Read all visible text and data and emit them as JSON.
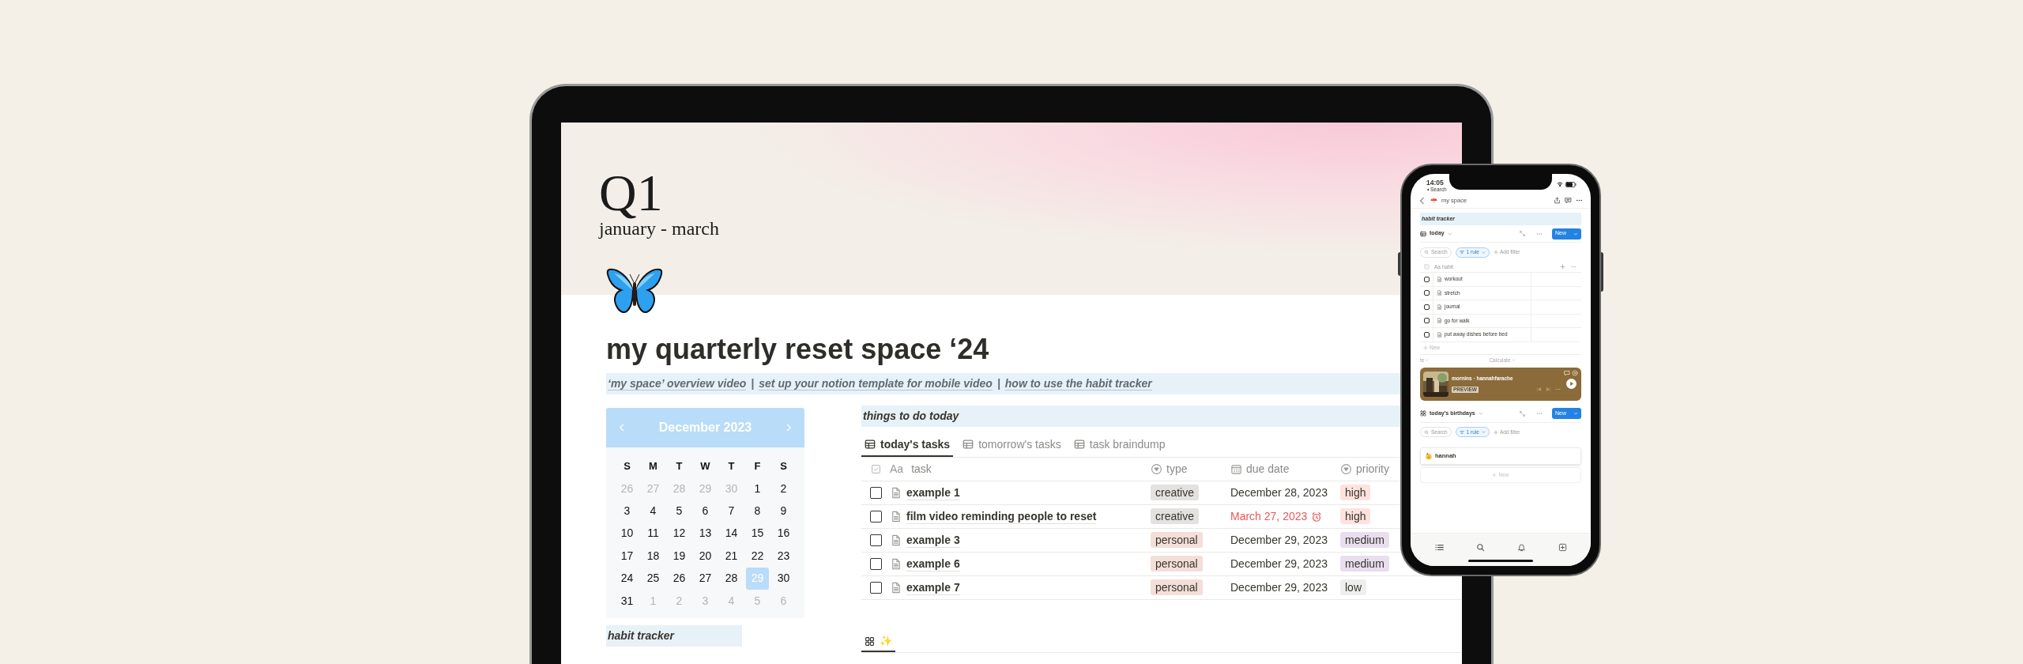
{
  "laptop": {
    "cover": {
      "title": "Q1",
      "subtitle": "january - march"
    },
    "page_title": "my quarterly reset space ‘24",
    "links": [
      {
        "kind": "link",
        "text": "‘my space’ overview video"
      },
      {
        "kind": "separator",
        "text": "|"
      },
      {
        "kind": "link",
        "text": "set up your notion template for mobile video"
      },
      {
        "kind": "separator",
        "text": "|"
      },
      {
        "kind": "link",
        "text": "how to use the habit tracker"
      }
    ],
    "calendar": {
      "month": "December 2023",
      "weekdays": [
        "S",
        "M",
        "T",
        "W",
        "T",
        "F",
        "S"
      ],
      "days": [
        {
          "label": "26",
          "outside": true,
          "selected": false
        },
        {
          "label": "27",
          "outside": true,
          "selected": false
        },
        {
          "label": "28",
          "outside": true,
          "selected": false
        },
        {
          "label": "29",
          "outside": true,
          "selected": false
        },
        {
          "label": "30",
          "outside": true,
          "selected": false
        },
        {
          "label": "1",
          "outside": false,
          "selected": false
        },
        {
          "label": "2",
          "outside": false,
          "selected": false
        },
        {
          "label": "3",
          "outside": false,
          "selected": false
        },
        {
          "label": "4",
          "outside": false,
          "selected": false
        },
        {
          "label": "5",
          "outside": false,
          "selected": false
        },
        {
          "label": "6",
          "outside": false,
          "selected": false
        },
        {
          "label": "7",
          "outside": false,
          "selected": false
        },
        {
          "label": "8",
          "outside": false,
          "selected": false
        },
        {
          "label": "9",
          "outside": false,
          "selected": false
        },
        {
          "label": "10",
          "outside": false,
          "selected": false
        },
        {
          "label": "11",
          "outside": false,
          "selected": false
        },
        {
          "label": "12",
          "outside": false,
          "selected": false
        },
        {
          "label": "13",
          "outside": false,
          "selected": false
        },
        {
          "label": "14",
          "outside": false,
          "selected": false
        },
        {
          "label": "15",
          "outside": false,
          "selected": false
        },
        {
          "label": "16",
          "outside": false,
          "selected": false
        },
        {
          "label": "17",
          "outside": false,
          "selected": false
        },
        {
          "label": "18",
          "outside": false,
          "selected": false
        },
        {
          "label": "19",
          "outside": false,
          "selected": false
        },
        {
          "label": "20",
          "outside": false,
          "selected": false
        },
        {
          "label": "21",
          "outside": false,
          "selected": false
        },
        {
          "label": "22",
          "outside": false,
          "selected": false
        },
        {
          "label": "23",
          "outside": false,
          "selected": false
        },
        {
          "label": "24",
          "outside": false,
          "selected": false
        },
        {
          "label": "25",
          "outside": false,
          "selected": false
        },
        {
          "label": "26",
          "outside": false,
          "selected": false
        },
        {
          "label": "27",
          "outside": false,
          "selected": false
        },
        {
          "label": "28",
          "outside": false,
          "selected": false
        },
        {
          "label": "29",
          "outside": false,
          "selected": true
        },
        {
          "label": "30",
          "outside": false,
          "selected": false
        },
        {
          "label": "31",
          "outside": false,
          "selected": false
        },
        {
          "label": "1",
          "outside": true,
          "selected": false
        },
        {
          "label": "2",
          "outside": true,
          "selected": false
        },
        {
          "label": "3",
          "outside": true,
          "selected": false
        },
        {
          "label": "4",
          "outside": true,
          "selected": false
        },
        {
          "label": "5",
          "outside": true,
          "selected": false
        },
        {
          "label": "6",
          "outside": true,
          "selected": false
        }
      ]
    },
    "habit_tracker": {
      "title": "habit tracker"
    },
    "tasks": {
      "title": "things to do today",
      "tabs": [
        {
          "label": "today's tasks",
          "selected": true
        },
        {
          "label": "tomorrow's tasks",
          "selected": false
        },
        {
          "label": "task braindump",
          "selected": false
        }
      ],
      "columns": [
        {
          "kind": "title",
          "prefix": "Aa",
          "label": "task"
        },
        {
          "kind": "select",
          "label": "type"
        },
        {
          "kind": "date",
          "label": "due date"
        },
        {
          "kind": "select",
          "label": "priority"
        }
      ],
      "rows": [
        {
          "checked": false,
          "task": "example 1",
          "type": {
            "label": "creative",
            "color": "#e3e2e0"
          },
          "due": {
            "text": "December 28, 2023",
            "overdue": false
          },
          "priority": {
            "label": "high",
            "color": "#ffe2dd"
          }
        },
        {
          "checked": false,
          "task": "film video reminding people to reset",
          "type": {
            "label": "creative",
            "color": "#e3e2e0"
          },
          "due": {
            "text": "March 27, 2023",
            "overdue": true
          },
          "priority": {
            "label": "high",
            "color": "#ffe2dd"
          }
        },
        {
          "checked": false,
          "task": "example 3",
          "type": {
            "label": "personal",
            "color": "#f4dfd8"
          },
          "due": {
            "text": "December 29, 2023",
            "overdue": false
          },
          "priority": {
            "label": "medium",
            "color": "#e8deee"
          }
        },
        {
          "checked": false,
          "task": "example 6",
          "type": {
            "label": "personal",
            "color": "#f4dfd8"
          },
          "due": {
            "text": "December 29, 2023",
            "overdue": false
          },
          "priority": {
            "label": "medium",
            "color": "#e8deee"
          }
        },
        {
          "checked": false,
          "task": "example 7",
          "type": {
            "label": "personal",
            "color": "#f4dfd8"
          },
          "due": {
            "text": "December 29, 2023",
            "overdue": false
          },
          "priority": {
            "label": "low",
            "color": "#eeeeed"
          }
        }
      ]
    },
    "bottom_tab": {
      "label": "✨",
      "selected": true
    }
  },
  "phone": {
    "time": "14:05",
    "back_label": "Search",
    "page": "my space",
    "habit": {
      "title": "habit tracker",
      "view": "today",
      "new": "New",
      "search": "Search",
      "filter": "1 rule",
      "add_filter": "Add filter",
      "column_prefix": "Aa",
      "column": "habit",
      "rows": [
        {
          "label": "workout",
          "checked": false
        },
        {
          "label": "stretch",
          "checked": false
        },
        {
          "label": "journal",
          "checked": false
        },
        {
          "label": "go for walk",
          "checked": false
        },
        {
          "label": "put away dishes before bed",
          "checked": false
        }
      ],
      "add_row": "New",
      "footer_left": "te",
      "footer_right": "Calculate"
    },
    "music": {
      "title": "mornins · hannahfarache",
      "badge": "PREVIEW"
    },
    "birthdays": {
      "view": "today's birthdays",
      "new": "New",
      "search": "Search",
      "filter": "1 rule",
      "add_filter": "Add filter",
      "cards": [
        {
          "name": "hannah"
        }
      ],
      "add_card": "New"
    }
  }
}
